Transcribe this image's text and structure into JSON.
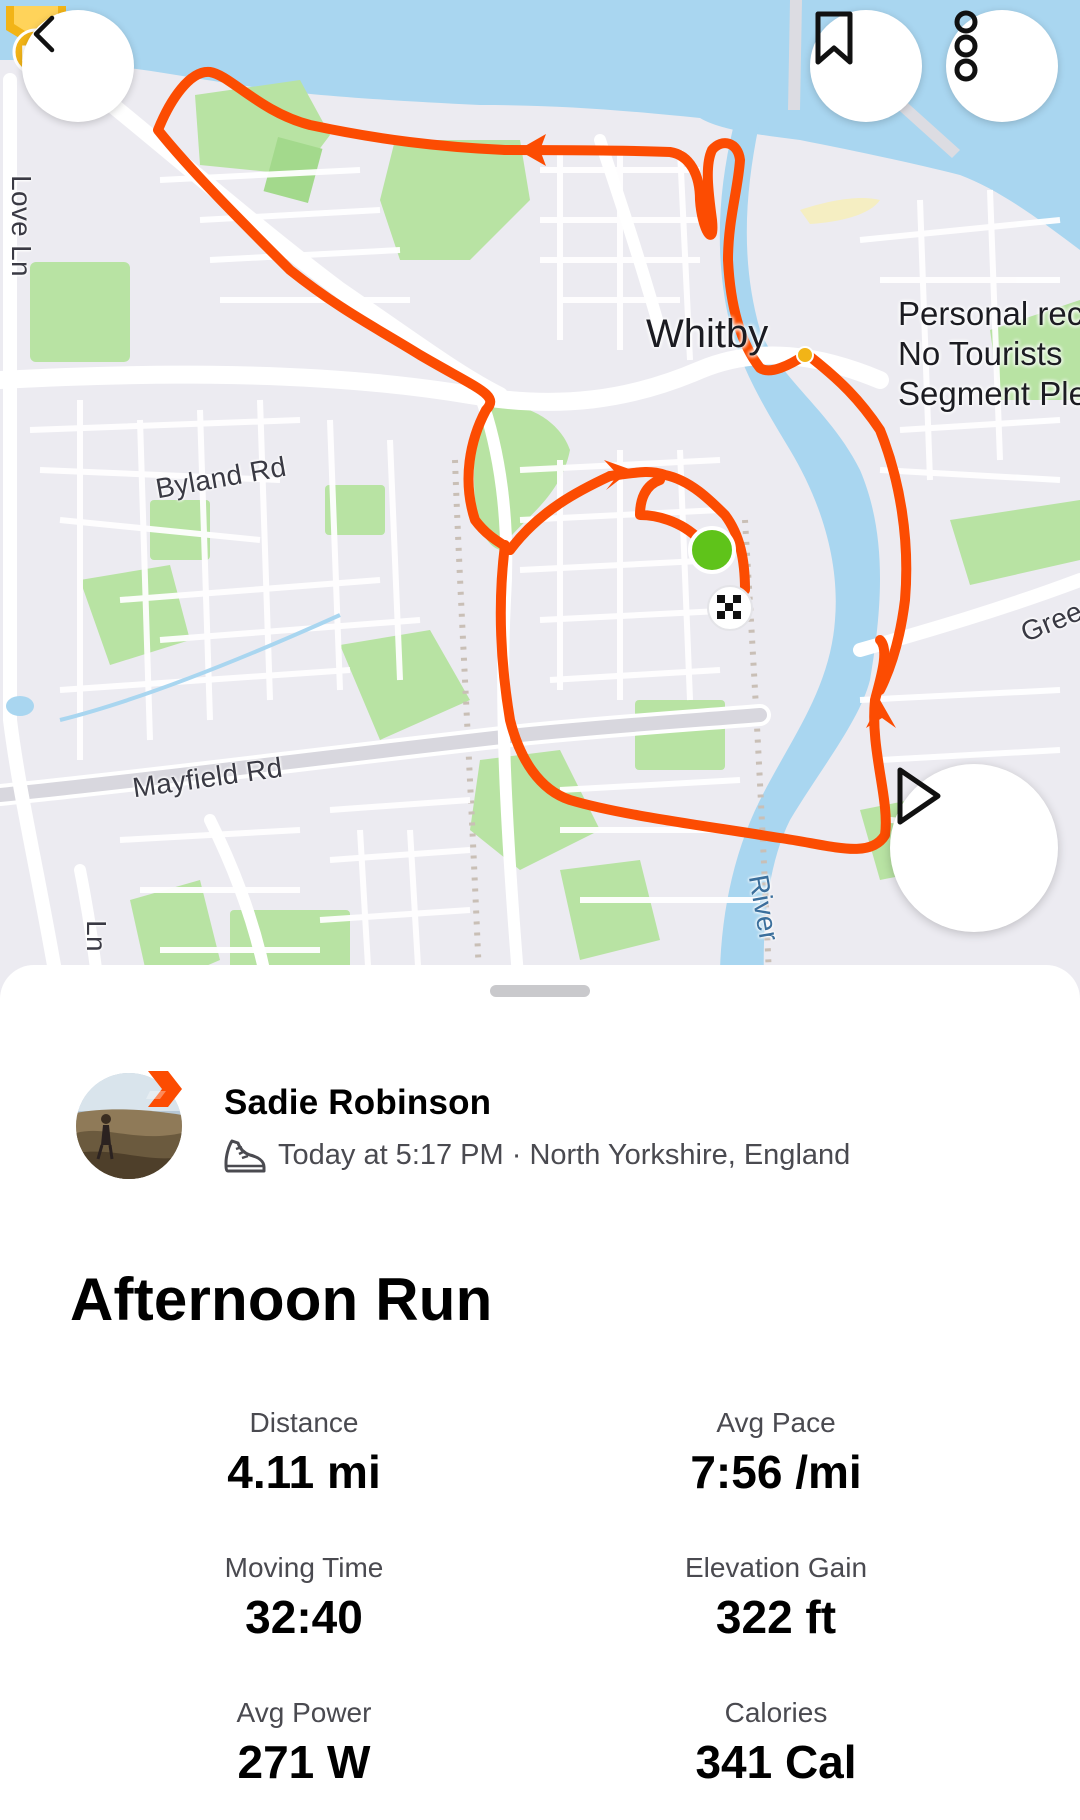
{
  "map": {
    "streets": {
      "love_ln": "Love Ln",
      "byland_rd": "Byland Rd",
      "mayfield_rd": "Mayfield Rd",
      "green_lane": "Gree",
      "river": "River",
      "lower_ln": "Ln"
    },
    "town": "Whitby",
    "personal_record": {
      "badge": "PR",
      "line1": "Personal rec",
      "line2": "No Tourists",
      "line3": "Segment Ple"
    },
    "colors": {
      "route": "#fc4c02",
      "water": "#a9d6f0",
      "park": "#b8e3a3",
      "land": "#ecebf1",
      "start": "#5fc31a"
    }
  },
  "toolbar": {
    "back_icon": "chevron-left-icon",
    "bookmark_icon": "bookmark-icon",
    "more_icon": "more-vertical-icon",
    "play_icon": "play-icon"
  },
  "athlete": {
    "name": "Sadie Robinson",
    "activity_icon": "running-shoe-icon",
    "meta": "Today at 5:17 PM · North Yorkshire, England"
  },
  "activity": {
    "title": "Afternoon Run"
  },
  "stats": [
    {
      "label": "Distance",
      "value": "4.11 mi"
    },
    {
      "label": "Avg Pace",
      "value": "7:56 /mi"
    },
    {
      "label": "Moving Time",
      "value": "32:40"
    },
    {
      "label": "Elevation Gain",
      "value": "322 ft"
    },
    {
      "label": "Avg Power",
      "value": "271 W"
    },
    {
      "label": "Calories",
      "value": "341 Cal"
    }
  ]
}
